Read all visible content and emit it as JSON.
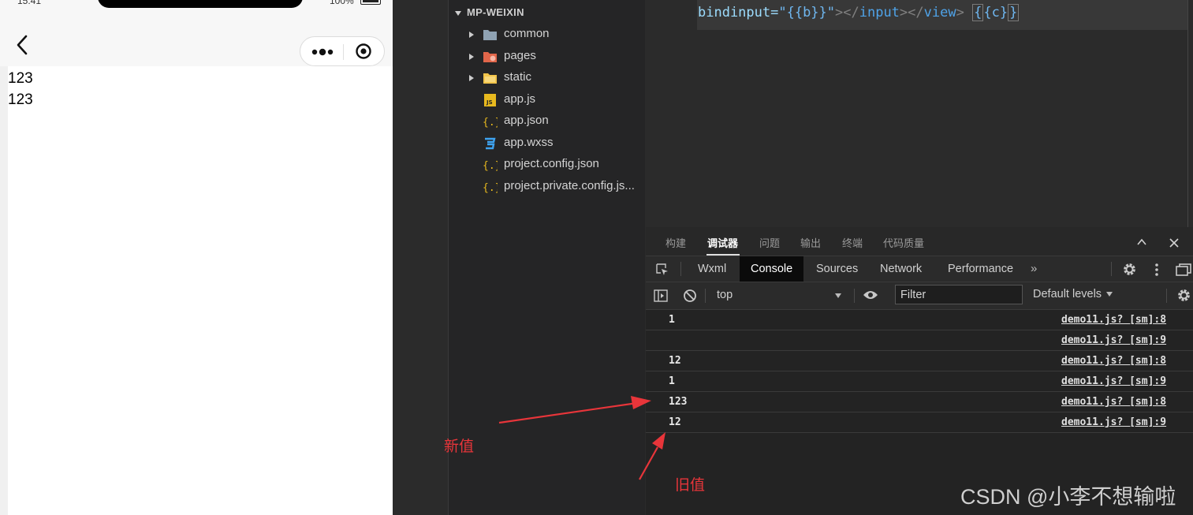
{
  "simulator": {
    "time": "15:41",
    "battery_pct": "100%",
    "lines": [
      "123",
      "123"
    ]
  },
  "explorer": {
    "title": "MP-WEIXIN",
    "items": [
      {
        "label": "common",
        "icon": "folder-icon",
        "expandable": true
      },
      {
        "label": "pages",
        "icon": "pages-folder-icon",
        "expandable": true
      },
      {
        "label": "static",
        "icon": "static-folder-icon",
        "expandable": true
      },
      {
        "label": "app.js",
        "icon": "js-file-icon",
        "expandable": false
      },
      {
        "label": "app.json",
        "icon": "json-file-icon",
        "expandable": false
      },
      {
        "label": "app.wxss",
        "icon": "css-file-icon",
        "expandable": false
      },
      {
        "label": "project.config.json",
        "icon": "json-file-icon",
        "expandable": false
      },
      {
        "label": "project.private.config.js...",
        "icon": "json-file-icon",
        "expandable": false
      }
    ]
  },
  "editor": {
    "code": {
      "attr": "bindinput=",
      "str": "\"{{b}}\"",
      "close1": "></",
      "tag1": "input",
      "close2": "></",
      "tag2": "view",
      "close3": ">",
      "mustache_open": "{",
      "mustache_body": "{c}",
      "mustache_close": "}"
    }
  },
  "panel": {
    "tabs": [
      "构建",
      "调试器",
      "问题",
      "输出",
      "终端",
      "代码质量"
    ],
    "active_tab": "调试器"
  },
  "devtools": {
    "tabs": [
      "Wxml",
      "Console",
      "Sources",
      "Network",
      "Performance"
    ],
    "active_tab": "Console",
    "more": "»"
  },
  "console": {
    "context": "top",
    "filter_placeholder": "Filter",
    "levels": "Default levels",
    "rows": [
      {
        "message": "1",
        "source": "demo11.js? [sm]:8"
      },
      {
        "message": "",
        "source": "demo11.js? [sm]:9"
      },
      {
        "message": "12",
        "source": "demo11.js? [sm]:8"
      },
      {
        "message": "1",
        "source": "demo11.js? [sm]:9"
      },
      {
        "message": "123",
        "source": "demo11.js? [sm]:8"
      },
      {
        "message": "12",
        "source": "demo11.js? [sm]:9"
      }
    ]
  },
  "annotations": {
    "new_value": "新值",
    "old_value": "旧值",
    "color": "#e8353a"
  },
  "watermark": "CSDN @小李不想输啦"
}
